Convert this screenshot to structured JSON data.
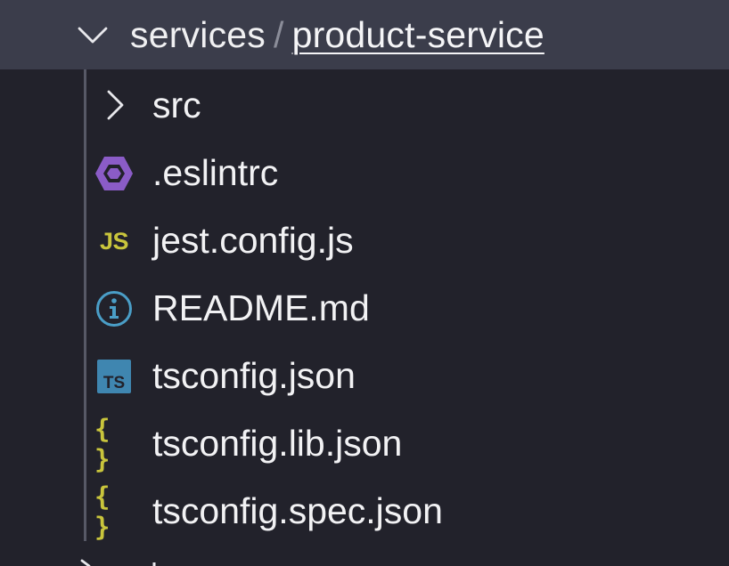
{
  "header": {
    "parent": "services",
    "separator": "/",
    "current": "product-service",
    "expanded_icon": "chevron-down-icon"
  },
  "tree": {
    "items": [
      {
        "label": "src",
        "kind": "folder",
        "icon": "chevron-right-icon"
      },
      {
        "label": ".eslintrc",
        "kind": "file",
        "icon": "eslint-icon"
      },
      {
        "label": "jest.config.js",
        "kind": "file",
        "icon": "javascript-icon",
        "badge": "JS"
      },
      {
        "label": "README.md",
        "kind": "file",
        "icon": "info-icon"
      },
      {
        "label": "tsconfig.json",
        "kind": "file",
        "icon": "typescript-icon",
        "badge": "TS"
      },
      {
        "label": "tsconfig.lib.json",
        "kind": "file",
        "icon": "json-icon",
        "badge": "{ }"
      },
      {
        "label": "tsconfig.spec.json",
        "kind": "file",
        "icon": "json-icon",
        "badge": "{ }"
      }
    ]
  },
  "colors": {
    "background": "#22222b",
    "header_background": "#3b3d4b",
    "eslint_purple": "#8b5cc7",
    "js_yellow": "#c9c53c",
    "info_blue": "#4a9ec7",
    "ts_blue": "#3f86b0"
  }
}
